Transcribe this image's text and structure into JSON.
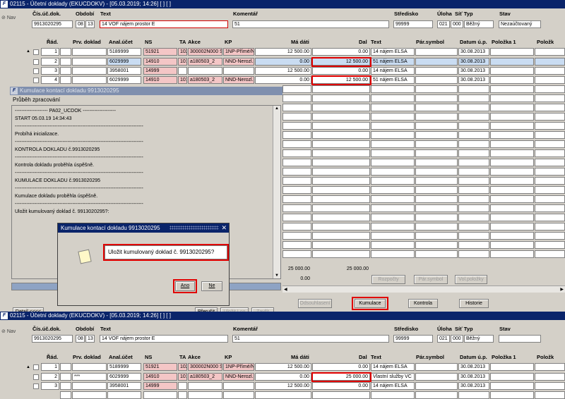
{
  "top_window": {
    "title": "02115 - Účetní doklady (EKUCDOKV) - [05.03.2019; 14:26]  [ ]  [ ]",
    "nav": "Nav"
  },
  "bottom_window": {
    "title": "02115 - Účetní doklady (EKUCDOKV) - [05.03.2019; 14:26]  [ ]  [ ]",
    "nav": "Nav"
  },
  "header_labels": {
    "doc_no": "Čís.úč.dok.",
    "period": "Období",
    "text": "Text",
    "comment": "Komentář",
    "center": "Středisko",
    "task": "Úloha",
    "net_type": "Síť Typ",
    "state": "Stav"
  },
  "header_values_top": {
    "doc_no": "9913020295",
    "period_a": "08",
    "period_b": "13",
    "text": "14 VOF nájem prostor E",
    "comment": "51",
    "center": "99999",
    "task": "021",
    "net": "000",
    "type": "Běžný",
    "state": "Nezaúčtovaný"
  },
  "header_values_bottom": {
    "doc_no": "9913020295",
    "period_a": "08",
    "period_b": "13",
    "text": "14 VOF nájem prostor E",
    "comment": "51",
    "center": "99999",
    "task": "021",
    "net": "000",
    "type": "Běžný",
    "state": ""
  },
  "grid_headers": {
    "row": "Řád.",
    "prv": "Prv. doklad",
    "anal": "Anal.účet",
    "ns": "NS",
    "ta": "TA",
    "akce": "Akce",
    "kp": "KP",
    "ma_dati": "Má dáti",
    "dal": "Dal",
    "text": "Text",
    "par_symbol": "Pár.symbol",
    "datum": "Datum ú.p.",
    "polozka1": "Položka 1",
    "polozka": "Položk"
  },
  "top_rows": [
    {
      "no": "1",
      "prv": "",
      "anal": "5189999",
      "ns": "51921",
      "ta": "102",
      "akce": "300002N000 S",
      "kp": "1NP-Přímé/N",
      "ma": "12 500.00",
      "dal": "0.00",
      "text": "14 nájem ELSA",
      "par": "",
      "datum": "30.08.2013"
    },
    {
      "no": "2",
      "prv": "",
      "anal": "6029999",
      "ns": "14910",
      "ta": "101",
      "akce": "a180503_2",
      "kp": "NND-Nerozl.",
      "ma": "0.00",
      "dal": "12 500.00",
      "text": "51 nájem ELSA",
      "par": "",
      "datum": "30.08.2013"
    },
    {
      "no": "3",
      "prv": "",
      "anal": "3958001",
      "ns": "14999",
      "ta": "",
      "akce": "",
      "kp": "",
      "ma": "12 500.00",
      "dal": "0.00",
      "text": "14 nájem ELSA",
      "par": "",
      "datum": "30.08.2013"
    },
    {
      "no": "4",
      "prv": "",
      "anal": "6029999",
      "ns": "14910",
      "ta": "101",
      "akce": "a180503_2",
      "kp": "NND-Nerozl.",
      "ma": "0.00",
      "dal": "12 500.00",
      "text": "51 nájem ELSA",
      "par": "",
      "datum": "30.08.2013"
    }
  ],
  "bottom_rows": [
    {
      "no": "1",
      "prv": "",
      "anal": "5189999",
      "ns": "51921",
      "ta": "102",
      "akce": "300002N000 S",
      "kp": "1NP-Přímé/N",
      "ma": "12 500.00",
      "dal": "0.00",
      "text": "14 nájem ELSA",
      "par": "",
      "datum": "30.08.2013"
    },
    {
      "no": "2",
      "prv": "***",
      "anal": "6029999",
      "ns": "14910",
      "ta": "101",
      "akce": "a180503_2",
      "kp": "NND-Nerozl.",
      "ma": "0.00",
      "dal": "25 000.00",
      "text": "Vlastní služby VC",
      "par": "",
      "datum": "30.08.2013"
    },
    {
      "no": "3",
      "prv": "",
      "anal": "3958001",
      "ns": "14999",
      "ta": "",
      "akce": "",
      "kp": "",
      "ma": "12 500.00",
      "dal": "0.00",
      "text": "14 nájem ELSA",
      "par": "",
      "datum": "30.08.2013"
    }
  ],
  "totals": {
    "ma_dati": "25 000.00",
    "dal": "25 000.00",
    "diff": "0.00",
    "diff_b": "0.00"
  },
  "bottom_buttons": {
    "rozpocty": "Rozpočty",
    "par_symbol": "Pár.symbol",
    "vol_polozky": "Vol.položky",
    "odsouhlaseni": "Odsouhlasení",
    "kumulace": "Kumulace",
    "kontrola": "Kontrola",
    "historie": "Historie"
  },
  "progress_window": {
    "title": "Kumulace kontací dokladu 9913020295",
    "subtitle": "Průběh zpracování",
    "log": "-------------------- PA02_UCDOK --------------------\nSTART 05.03.19 14:34:43\n------------------------------------------------------------------------------\nProbíhá inicializace.\n------------------------------------------------------------------------------\nKONTROLA DOKLADU č.9913020295\n------------------------------------------------------------------------------\nKontrola dokladu proběhla úspěšně.\n------------------------------------------------------------------------------\nKUMULACE DOKLADU č.9913020295\n------------------------------------------------------------------------------\nKumulace dokladu proběhla úspěšně.\n------------------------------------------------------------------------------\nUložit kumulovaný doklad č. 9913020295?:",
    "detail_btn": "Detail <<<<",
    "prerusit_btn": "Přerušit",
    "ulozit_log_btn": "Uložit Log",
    "zavrit_btn": "Zavřít"
  },
  "dialog": {
    "title": "Kumulace kontací dokladu 9913020295",
    "message": "Uložit kumulovaný doklad č. 9913020295?",
    "yes": "Ano",
    "no": "Ne"
  }
}
